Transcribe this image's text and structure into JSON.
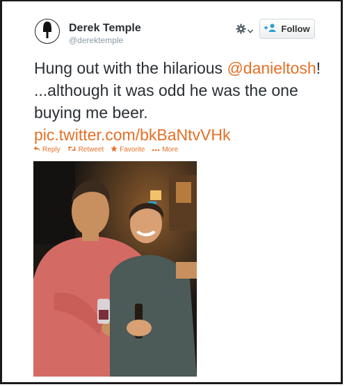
{
  "tweet": {
    "author_name": "Derek Temple",
    "author_handle": "@derektemple",
    "follow_label": "Follow",
    "text_part1": "Hung out with the hilarious ",
    "mention": "@danieltosh",
    "text_part2": "! ...although it was odd he was the one buying me beer.",
    "link": "pic.twitter.com/bkBaNtvVHk",
    "actions": {
      "reply": "Reply",
      "retweet": "Retweet",
      "favorite": "Favorite",
      "more": "More"
    }
  },
  "icons": {
    "avatar": "popsicle-icon",
    "settings": "gear-icon",
    "follow": "add-user-icon",
    "reply": "reply-arrow-icon",
    "retweet": "retweet-icon",
    "favorite": "star-icon",
    "more": "ellipsis-icon"
  },
  "colors": {
    "accent": "#e56f25",
    "follow_icon": "#2e9fd4",
    "name_text": "#292f33",
    "handle_text": "#8899a6"
  }
}
